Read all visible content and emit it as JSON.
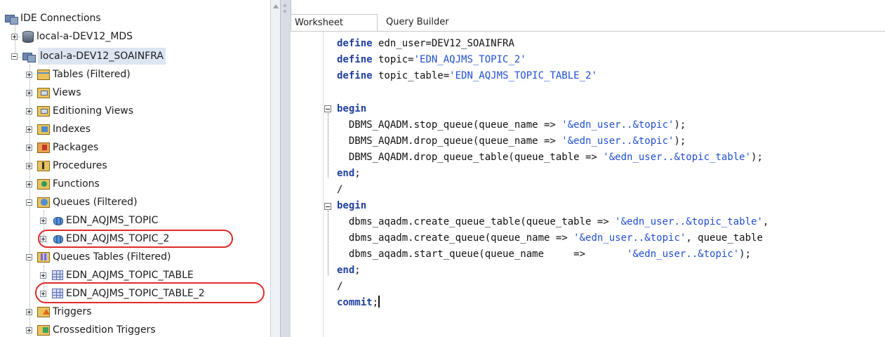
{
  "tree": {
    "root": "IDE Connections",
    "connections": [
      "local-a-DEV12_MDS",
      "local-a-DEV12_SOAINFRA"
    ],
    "folders": {
      "tables": "Tables (Filtered)",
      "views": "Views",
      "editioning_views": "Editioning Views",
      "indexes": "Indexes",
      "packages": "Packages",
      "procedures": "Procedures",
      "functions": "Functions",
      "queues": "Queues (Filtered)",
      "queue_tables": "Queues Tables (Filtered)",
      "triggers": "Triggers",
      "crossedition_triggers": "Crossedition Triggers"
    },
    "queues": [
      "EDN_AQJMS_TOPIC",
      "EDN_AQJMS_TOPIC_2"
    ],
    "queue_tables": [
      "EDN_AQJMS_TOPIC_TABLE",
      "EDN_AQJMS_TOPIC_TABLE_2"
    ]
  },
  "tabs": {
    "worksheet": "Worksheet",
    "query_builder": "Query Builder"
  },
  "code": {
    "l1_kw": "define",
    "l1_rest": " edn_user=DEV12_SOAINFRA",
    "l2_kw": "define",
    "l2_rest": " topic=",
    "l2_str": "'EDN_AQJMS_TOPIC_2'",
    "l3_kw": "define",
    "l3_rest": " topic_table=",
    "l3_str": "'EDN_AQJMS_TOPIC_TABLE_2'",
    "l5_kw": "begin",
    "l6_a": "  DBMS_AQADM.stop_queue(queue_name => ",
    "l6_str": "'&edn_user..&topic'",
    "l6_b": ");",
    "l7_a": "  DBMS_AQADM.drop_queue(queue_name => ",
    "l7_str": "'&edn_user..&topic'",
    "l7_b": ");",
    "l8_a": "  DBMS_AQADM.drop_queue_table(queue_table => ",
    "l8_str": "'&edn_user..&topic_table'",
    "l8_b": ");",
    "l9_kw": "end",
    "l9_b": ";",
    "l10": "/",
    "l11_kw": "begin",
    "l12_a": "  dbms_aqadm.create_queue_table(queue_table => ",
    "l12_str": "'&edn_user..&topic_table'",
    "l12_b": ",",
    "l13_a": "  dbms_aqadm.create_queue(queue_name => ",
    "l13_str": "'&edn_user..&topic'",
    "l13_b": ", queue_table",
    "l14_a": "  dbms_aqadm.start_queue(queue_name     =>       ",
    "l14_str": "'&edn_user..&topic'",
    "l14_b": ");",
    "l15_kw": "end",
    "l15_b": ";",
    "l16": "/",
    "l17_kw": "commit",
    "l17_b": ";"
  }
}
